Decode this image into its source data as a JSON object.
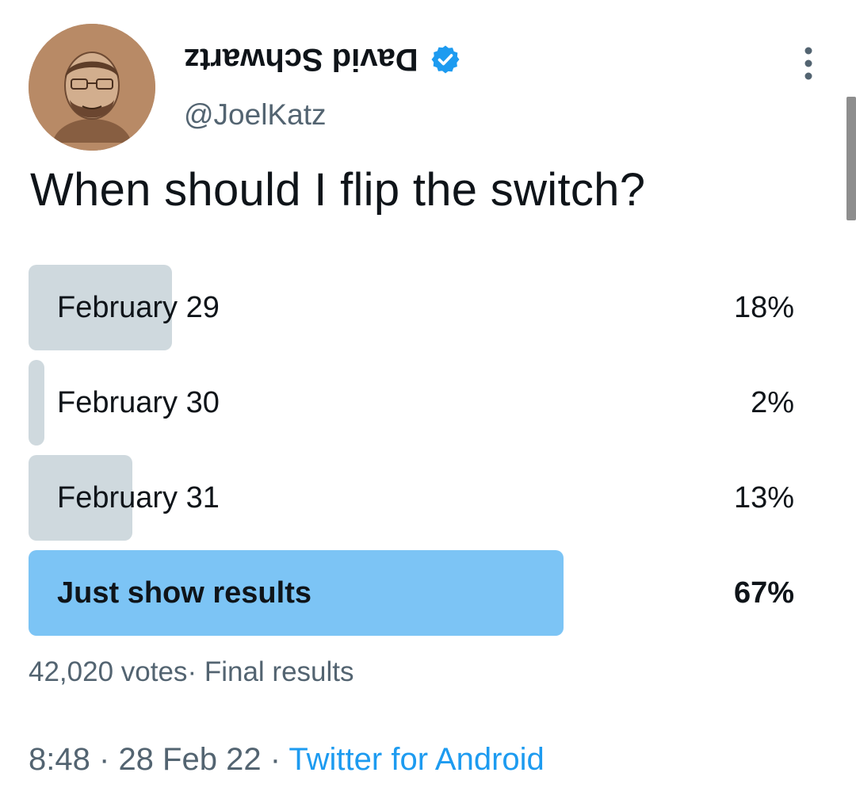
{
  "author": {
    "display_name": "David Schwartz",
    "handle": "@JoelKatz",
    "verified": true,
    "avatar_icon": "profile-avatar-sketch"
  },
  "tweet": {
    "text": "When should I flip the switch?"
  },
  "poll": {
    "options": [
      {
        "label": "February 29",
        "percent_text": "18%",
        "percent": 18,
        "winner": false
      },
      {
        "label": "February 30",
        "percent_text": "2%",
        "percent": 2,
        "winner": false
      },
      {
        "label": "February 31",
        "percent_text": "13%",
        "percent": 13,
        "winner": false
      },
      {
        "label": "Just show results",
        "percent_text": "67%",
        "percent": 67,
        "winner": true
      }
    ],
    "votes_text": "42,020 votes",
    "separator": "·",
    "status_text": "Final results"
  },
  "meta": {
    "time": "8:48",
    "dot": "·",
    "date": "28 Feb 22",
    "source": "Twitter for Android"
  },
  "colors": {
    "accent": "#1d9bf0",
    "bar_fill": "#cfd9de",
    "winner_fill": "#7cc4f5",
    "secondary_text": "#536471"
  }
}
